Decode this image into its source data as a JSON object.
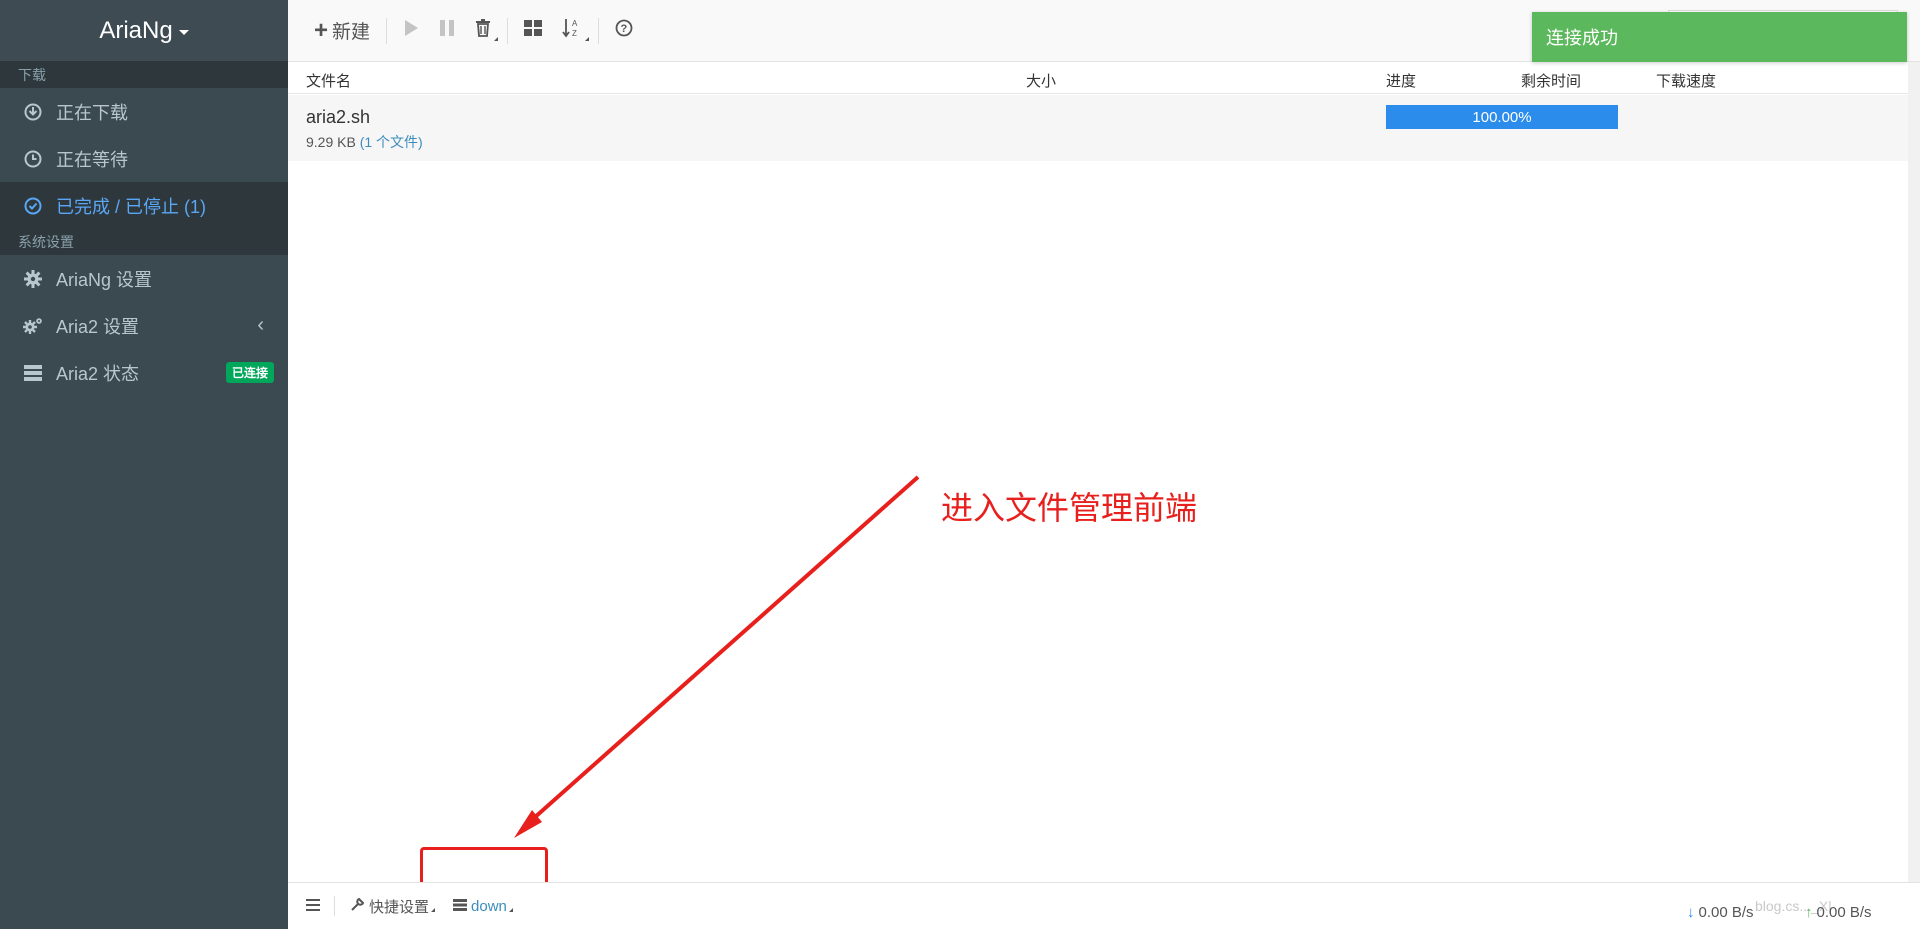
{
  "sidebar": {
    "brand": "AriaNg",
    "section_download": "下载",
    "items_download": [
      {
        "label": "正在下载",
        "icon": "download-circle-icon"
      },
      {
        "label": "正在等待",
        "icon": "clock-icon"
      },
      {
        "label": "已完成 / 已停止 (1)",
        "icon": "check-circle-icon"
      }
    ],
    "section_settings": "系统设置",
    "items_settings": [
      {
        "label": "AriaNg 设置",
        "icon": "gear-icon"
      },
      {
        "label": "Aria2 设置",
        "icon": "gears-icon"
      },
      {
        "label": "Aria2 状态",
        "icon": "server-icon",
        "badge": "已连接"
      }
    ]
  },
  "toolbar": {
    "new_label": "新建"
  },
  "toast": {
    "text": "连接成功",
    "color": "#5cb85c"
  },
  "table": {
    "headers": {
      "name": "文件名",
      "size": "大小",
      "progress": "进度",
      "remaining": "剩余时间",
      "speed": "下载速度"
    },
    "rows": [
      {
        "name": "aria2.sh",
        "size": "9.29 KB",
        "files_link": "(1 个文件)",
        "progress_label": "100.00%",
        "progress": 1.0
      }
    ]
  },
  "annotation": {
    "text": "进入文件管理前端",
    "color": "#e8201d"
  },
  "footer": {
    "quick_settings": "快捷设置",
    "down_label": "down",
    "download_speed": "0.00 B/s",
    "upload_speed": "0.00 B/s",
    "watermark": "blog.cs..._X|"
  },
  "colors": {
    "sidebar_bg": "#3b4950",
    "accent": "#3c8dbc",
    "progress": "#2b8ceb",
    "badge": "#00a65a"
  }
}
